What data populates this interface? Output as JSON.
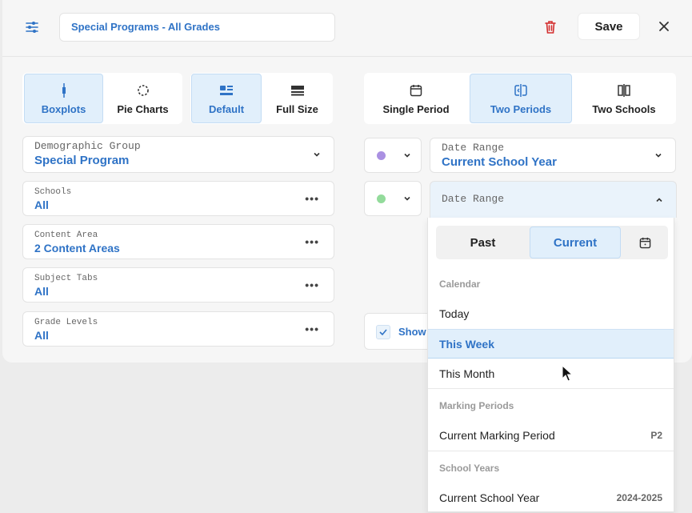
{
  "header": {
    "title_value": "Special Programs - All Grades",
    "save_label": "Save"
  },
  "chart_type": {
    "options": [
      {
        "label": "Boxplots",
        "active": true
      },
      {
        "label": "Pie Charts",
        "active": false
      }
    ]
  },
  "size_mode": {
    "options": [
      {
        "label": "Default",
        "active": true
      },
      {
        "label": "Full Size",
        "active": false
      }
    ]
  },
  "comparison": {
    "options": [
      {
        "label": "Single Period",
        "active": false
      },
      {
        "label": "Two Periods",
        "active": true
      },
      {
        "label": "Two Schools",
        "active": false
      }
    ]
  },
  "filters": {
    "demographic": {
      "label": "Demographic Group",
      "value": "Special Program"
    },
    "schools": {
      "label": "Schools",
      "value": "All"
    },
    "content_area": {
      "label": "Content Area",
      "value": "2 Content Areas"
    },
    "subject_tabs": {
      "label": "Subject Tabs",
      "value": "All"
    },
    "grade_levels": {
      "label": "Grade Levels",
      "value": "All"
    }
  },
  "periods": {
    "first": {
      "color": "#8e6bd8",
      "label": "Date Range",
      "value": "Current School Year"
    },
    "second": {
      "color": "#6fcf7a",
      "label": "Date Range"
    }
  },
  "show_checkbox": {
    "label": "Show",
    "checked": true
  },
  "dropdown": {
    "tabs": {
      "past": "Past",
      "current": "Current"
    },
    "calendar_heading": "Calendar",
    "today": "Today",
    "this_week": "This Week",
    "this_month": "This Month",
    "marking_heading": "Marking Periods",
    "current_marking": "Current Marking Period",
    "current_marking_code": "P2",
    "school_years_heading": "School Years",
    "current_school_year": "Current School Year",
    "current_school_year_value": "2024-2025"
  },
  "colors": {
    "accent": "#2f73c6",
    "active_bg": "#e1effb",
    "delete": "#d32f2f"
  }
}
